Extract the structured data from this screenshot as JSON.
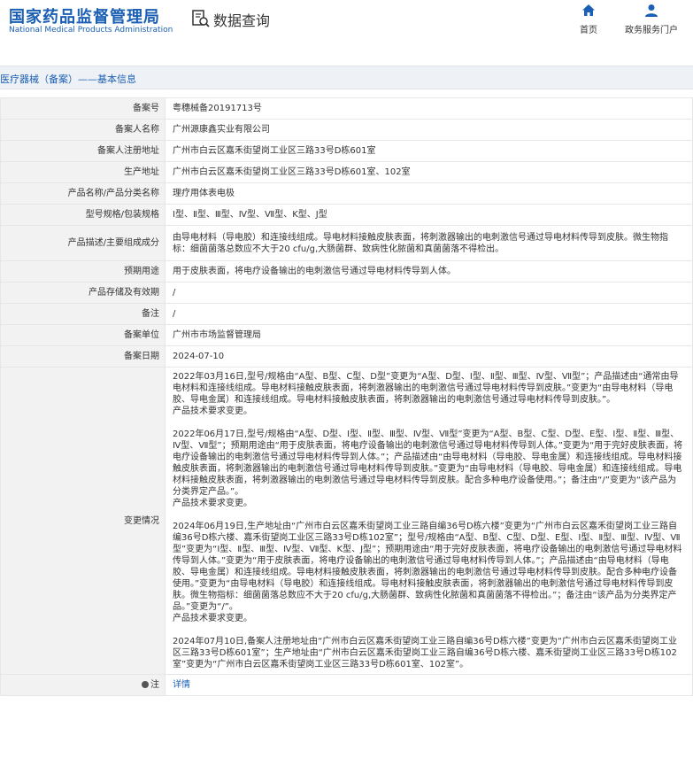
{
  "header": {
    "logo_cn": "国家药品监督管理局",
    "logo_en": "National Medical Products Administration",
    "data_query": "数据查询",
    "nav_home": "首页",
    "nav_service": "政务服务门户"
  },
  "breadcrumb": "医疗器械（备案）——基本信息",
  "rows": [
    {
      "label": "备案号",
      "value": "粤穗械备20191713号"
    },
    {
      "label": "备案人名称",
      "value": "广州源康鑫实业有限公司"
    },
    {
      "label": "备案人注册地址",
      "value": "广州市白云区嘉禾街望岗工业区三路33号D栋601室"
    },
    {
      "label": "生产地址",
      "value": "广州市白云区嘉禾街望岗工业区三路33号D栋601室、102室"
    },
    {
      "label": "产品名称/产品分类名称",
      "value": "理疗用体表电极"
    },
    {
      "label": "型号规格/包装规格",
      "value": "Ⅰ型、Ⅱ型、Ⅲ型、Ⅳ型、Ⅶ型、K型、J型"
    },
    {
      "label": "产品描述/主要组成成分",
      "value": "由导电材料（导电胶）和连接线组成。导电材料接触皮肤表面，将刺激器输出的电刺激信号通过导电材料传导到皮肤。微生物指标：细菌菌落总数应不大于20 cfu/g,大肠菌群、致病性化脓菌和真菌菌落不得检出。"
    },
    {
      "label": "预期用途",
      "value": "用于皮肤表面，将电疗设备输出的电刺激信号通过导电材料传导到人体。"
    },
    {
      "label": "产品存储及有效期",
      "value": "/"
    },
    {
      "label": "备注",
      "value": "/"
    },
    {
      "label": "备案单位",
      "value": "广州市市场监督管理局"
    },
    {
      "label": "备案日期",
      "value": "2024-07-10"
    }
  ],
  "changes": {
    "label": "变更情况",
    "paragraphs": [
      "2022年03月16日,型号/规格由“A型、B型、C型、D型”变更为“A型、D型、Ⅰ型、Ⅱ型、Ⅲ型、Ⅳ型、Ⅶ型”；产品描述由“通常由导电材料和连接线组成。导电材料接触皮肤表面，将刺激器输出的电刺激信号通过导电材料传导到皮肤。”变更为“由导电材料（导电胶、导电金属）和连接线组成。导电材料接触皮肤表面，将刺激器输出的电刺激信号通过导电材料传导到皮肤。”。\n产品技术要求变更。",
      "2022年06月17日,型号/规格由“A型、D型、Ⅰ型、Ⅱ型、Ⅲ型、Ⅳ型、Ⅶ型”变更为“A型、B型、C型、D型、E型、Ⅰ型、Ⅱ型、Ⅲ型、Ⅳ型、Ⅶ型”；预期用途由“用于皮肤表面，将电疗设备输出的电刺激信号通过导电材料传导到人体。”变更为“用于完好皮肤表面，将电疗设备输出的电刺激信号通过导电材料传导到人体。”；产品描述由“由导电材料（导电胶、导电金属）和连接线组成。导电材料接触皮肤表面，将刺激器输出的电刺激信号通过导电材料传导到皮肤。”变更为“由导电材料（导电胶、导电金属）和连接线组成。导电材料接触皮肤表面，将刺激器输出的电刺激信号通过导电材料传导到皮肤。配合多种电疗设备使用。”；备注由“/”变更为“该产品为分类界定产品。”。\n产品技术要求变更。",
      "2024年06月19日,生产地址由“广州市白云区嘉禾街望岗工业三路自编36号D栋六楼”变更为“广州市白云区嘉禾街望岗工业三路自编36号D栋六楼、嘉禾街望岗工业区三路33号D栋102室”；型号/规格由“A型、B型、C型、D型、E型、Ⅰ型、Ⅱ型、Ⅲ型、Ⅳ型、Ⅶ型”变更为“Ⅰ型、Ⅱ型、Ⅲ型、Ⅳ型、Ⅶ型、K型、J型”；预期用途由“用于完好皮肤表面，将电疗设备输出的电刺激信号通过导电材料传导到人体。”变更为“用于皮肤表面，将电疗设备输出的电刺激信号通过导电材料传导到人体。”；产品描述由“由导电材料（导电胶、导电金属）和连接线组成。导电材料接触皮肤表面，将刺激器输出的电刺激信号通过导电材料传导到皮肤。配合多种电疗设备使用。”变更为“由导电材料（导电胶）和连接线组成。导电材料接触皮肤表面，将刺激器输出的电刺激信号通过导电材料传导到皮肤。微生物指标：细菌菌落总数应不大于20 cfu/g,大肠菌群、致病性化脓菌和真菌菌落不得检出。”；备注由“该产品为分类界定产品。”变更为“/”。\n产品技术要求变更。",
      "2024年07月10日,备案人注册地址由“广州市白云区嘉禾街望岗工业三路自编36号D栋六楼”变更为“广州市白云区嘉禾街望岗工业区三路33号D栋601室”；生产地址由“广州市白云区嘉禾街望岗工业三路自编36号D栋六楼、嘉禾街望岗工业区三路33号D栋102室”变更为“广州市白云区嘉禾街望岗工业区三路33号D栋601室、102室”。"
    ]
  },
  "note": {
    "label": "注",
    "link": "详情"
  }
}
